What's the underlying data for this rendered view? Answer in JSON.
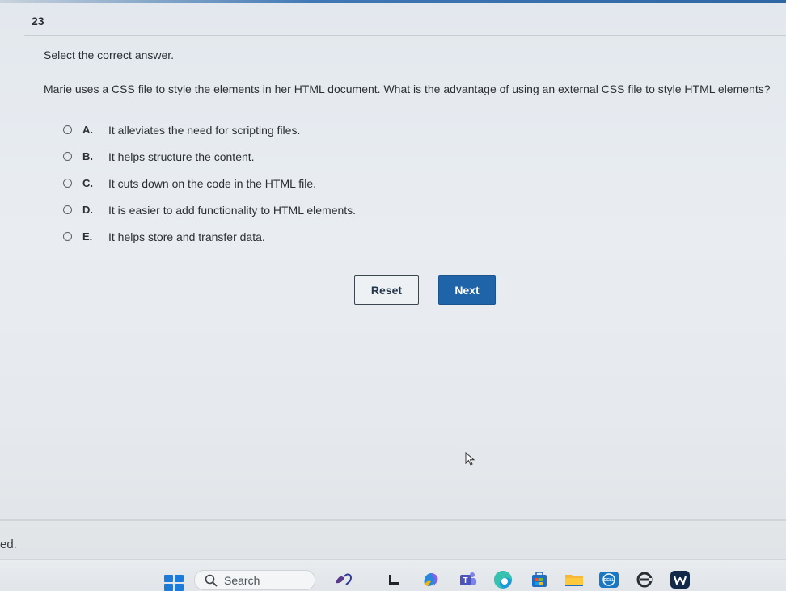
{
  "question": {
    "number": "23",
    "instruction": "Select the correct answer.",
    "text": "Marie uses a CSS file to style the elements in her HTML document. What is the advantage of using an external CSS file to style HTML elements?",
    "options": [
      {
        "letter": "A.",
        "text": "It alleviates the need for scripting files."
      },
      {
        "letter": "B.",
        "text": "It helps structure the content."
      },
      {
        "letter": "C.",
        "text": "It cuts down on the code in the HTML file."
      },
      {
        "letter": "D.",
        "text": "It is easier to add functionality to HTML elements."
      },
      {
        "letter": "E.",
        "text": "It helps store and transfer data."
      }
    ]
  },
  "buttons": {
    "reset_label": "Reset",
    "next_label": "Next"
  },
  "edge_text": "ed.",
  "taskbar": {
    "search_label": "Search",
    "apps": [
      "start-icon",
      "widgets-icon",
      "terminal-icon",
      "copilot-icon",
      "teams-icon",
      "edge-icon",
      "store-icon",
      "file-explorer-icon",
      "dell-icon",
      "chrome-icon",
      "app-icon"
    ]
  },
  "colors": {
    "accent": "#1f63a8",
    "taskbar_start": "#1c7ad8"
  }
}
